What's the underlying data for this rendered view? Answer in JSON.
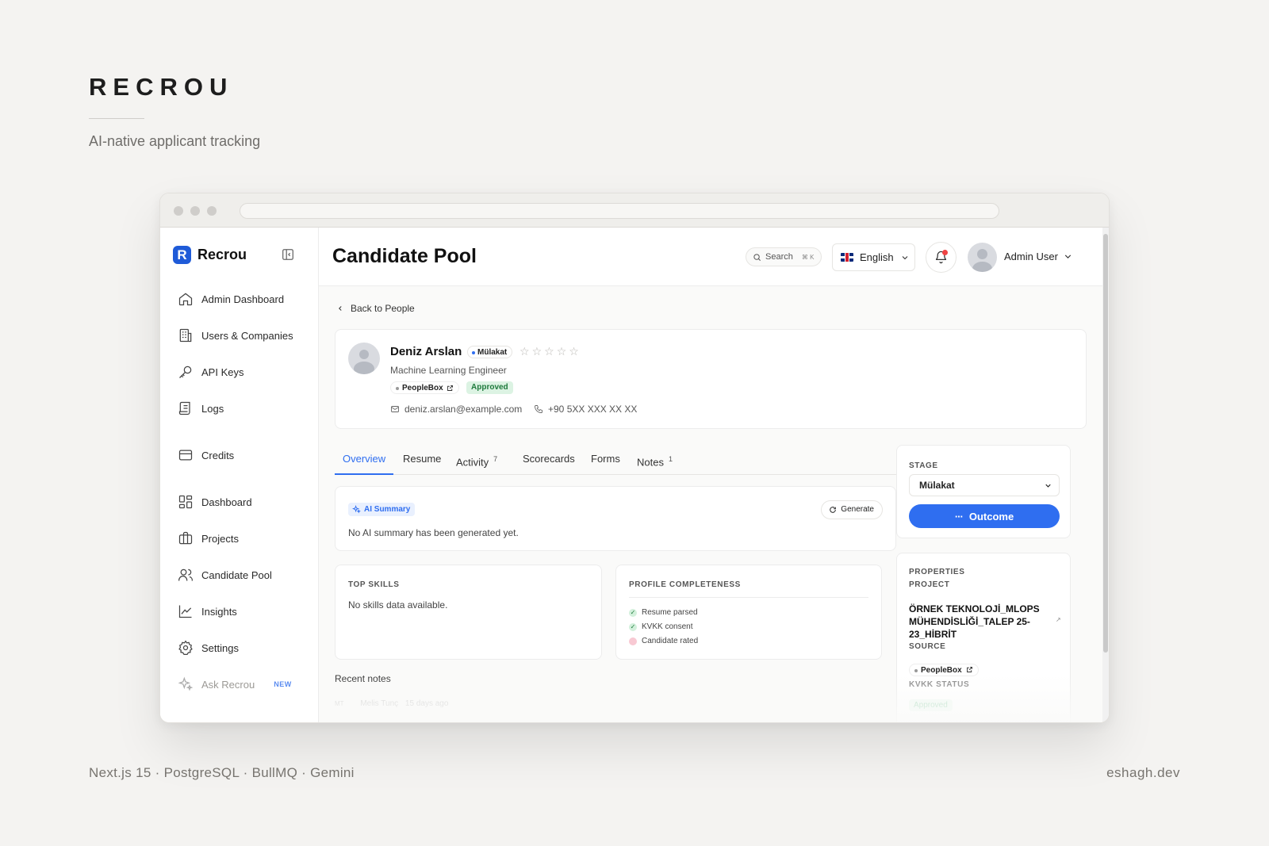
{
  "brand": {
    "title": "RECROU",
    "subtitle": "AI-native applicant tracking",
    "footer_left": "Next.js 15 · PostgreSQL · BullMQ · Gemini",
    "footer_right": "eshagh.dev"
  },
  "sidebar": {
    "logo_letter": "R",
    "logo_text": "Recrou",
    "items": [
      {
        "label": "Admin Dashboard",
        "icon": "home-icon"
      },
      {
        "label": "Users & Companies",
        "icon": "building-icon"
      },
      {
        "label": "API Keys",
        "icon": "key-icon"
      },
      {
        "label": "Logs",
        "icon": "scroll-icon"
      },
      {
        "label": "Credits",
        "icon": "credit-card-icon"
      },
      {
        "label": "Dashboard",
        "icon": "grid-icon"
      },
      {
        "label": "Projects",
        "icon": "briefcase-icon"
      },
      {
        "label": "Candidate Pool",
        "icon": "users-icon"
      },
      {
        "label": "Insights",
        "icon": "chart-icon"
      },
      {
        "label": "Settings",
        "icon": "gear-icon"
      },
      {
        "label": "Ask Recrou",
        "icon": "sparkle-icon",
        "badge": "NEW"
      }
    ]
  },
  "header": {
    "title": "Candidate Pool",
    "search_label": "Search",
    "search_shortcut": "⌘ K",
    "language": "English",
    "user_name": "Admin User"
  },
  "breadcrumb": {
    "back_label": "Back to People"
  },
  "candidate": {
    "name": "Deniz Arslan",
    "stage": "Mülakat",
    "rating": 0,
    "role": "Machine Learning Engineer",
    "source": "PeopleBox",
    "status": "Approved",
    "email": "deniz.arslan@example.com",
    "phone": "+90 5XX XXX XX XX"
  },
  "tabs": [
    {
      "label": "Overview",
      "count": ""
    },
    {
      "label": "Resume",
      "count": ""
    },
    {
      "label": "Activity",
      "count": "7"
    },
    {
      "label": "Scorecards",
      "count": ""
    },
    {
      "label": "Forms",
      "count": ""
    },
    {
      "label": "Notes",
      "count": "1"
    }
  ],
  "ai_summary": {
    "label": "AI Summary",
    "generate_label": "Generate",
    "empty_text": "No AI summary has been generated yet."
  },
  "top_skills": {
    "label": "TOP SKILLS",
    "empty_text": "No skills data available."
  },
  "profile_completeness": {
    "label": "PROFILE COMPLETENESS",
    "items": [
      {
        "label": "Resume parsed",
        "done": true
      },
      {
        "label": "KVKK consent",
        "done": true
      },
      {
        "label": "Candidate rated",
        "done": false
      }
    ]
  },
  "recent_notes": {
    "label": "Recent notes",
    "preview_initials": "MT",
    "preview_author": "Melis Tunç",
    "preview_time": "15 days ago"
  },
  "stage_panel": {
    "label": "STAGE",
    "selected": "Mülakat",
    "outcome_label": "Outcome"
  },
  "properties": {
    "label": "PROPERTIES",
    "project_label": "PROJECT",
    "project_value": "ÖRNEK TEKNOLOJİ_MLOPS MÜHENDİSLİĞİ_TALEP 25-23_HİBRİT",
    "source_label": "SOURCE",
    "source_value": "PeopleBox",
    "kvkk_label": "KVKK STATUS",
    "kvkk_value": "Approved"
  },
  "colors": {
    "accent": "#2f6ef0",
    "logo": "#1f5bd8",
    "approved_bg": "#dcf3e3",
    "approved_text": "#1e7a3c",
    "notification_dot": "#ef4444"
  }
}
